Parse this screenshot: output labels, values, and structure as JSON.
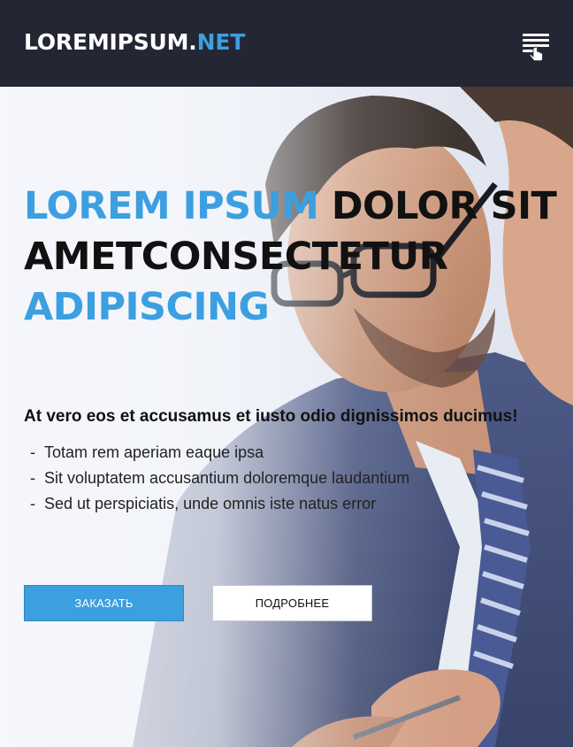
{
  "header": {
    "logo_main": "LOREMIPSUM.",
    "logo_accent": "NET",
    "menu_icon": "menu-hand-cursor-icon"
  },
  "hero": {
    "headline_blue_1": "LOREM IPSUM",
    "headline_dark_1": "DOLOR SIT AMETCONSECTETUR",
    "headline_blue_2": "ADIPISCING",
    "subheading": "At vero eos et accusamus et iusto odio dignissimos ducimus!",
    "bullets": [
      "Totam rem aperiam eaque ipsa",
      "Sit voluptatem accusantium doloremque laudantium",
      "Sed ut perspiciatis, unde omnis iste natus error"
    ],
    "order_button": "ЗАКАЗАТЬ",
    "more_button": "ПОДРОБНЕЕ",
    "background_image": "businessman-with-glasses-photo"
  },
  "colors": {
    "header_bg": "#252634",
    "accent": "#3c9fe0",
    "text_dark": "#111111"
  }
}
